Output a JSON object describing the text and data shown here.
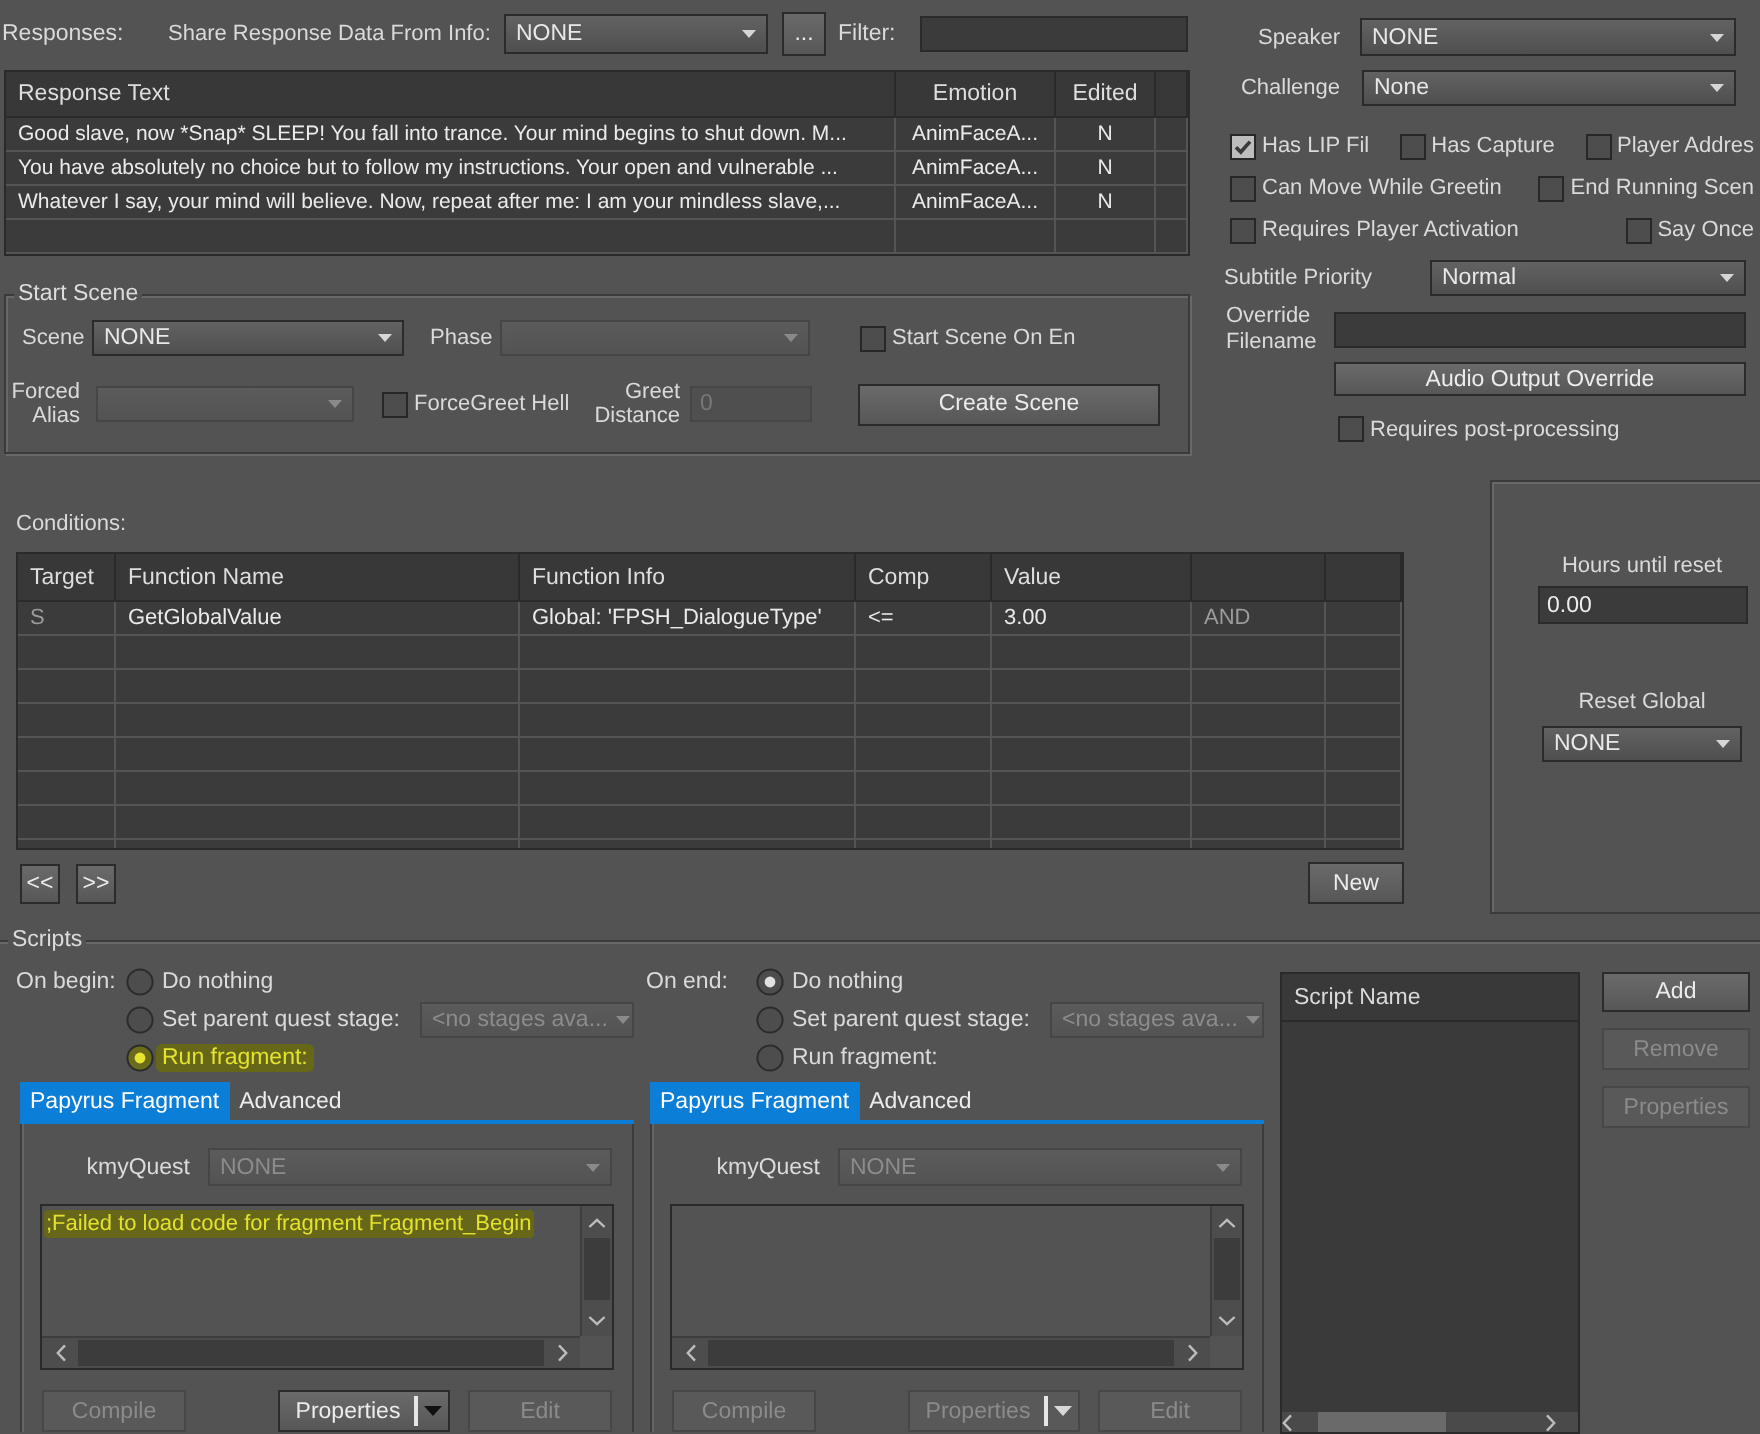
{
  "responses_bar": {
    "label": "Responses:",
    "share_label": "Share Response Data From Info:",
    "share_value": "NONE",
    "browse_button": "...",
    "filter_label": "Filter:"
  },
  "responses_table": {
    "columns": [
      "Response Text",
      "Emotion",
      "Edited"
    ],
    "rows": [
      [
        "Good slave, now *Snap* SLEEP! You fall into trance. Your mind begins to shut down. M...",
        "AnimFaceA...",
        "N"
      ],
      [
        "You have absolutely no choice but to follow my instructions. Your open and vulnerable ...",
        "AnimFaceA...",
        "N"
      ],
      [
        "Whatever I say, your mind will believe. Now, repeat after me: I am your mindless slave,...",
        "AnimFaceA...",
        "N"
      ]
    ]
  },
  "start_scene": {
    "title": "Start Scene",
    "scene": {
      "label": "Scene",
      "value": "NONE",
      "disabled": false
    },
    "phase": {
      "label": "Phase",
      "disabled": true
    },
    "start_on_end": {
      "label": "Start Scene On En",
      "checked": false
    },
    "forced_alias": {
      "label": "Forced Alias",
      "disabled": true
    },
    "force_greet": {
      "label": "ForceGreet Hell",
      "checked": false
    },
    "greet_distance": {
      "label": "Greet Distance",
      "value": "0",
      "disabled": true
    },
    "create_button": "Create Scene"
  },
  "dialogue": {
    "speaker": {
      "label": "Speaker",
      "value": "NONE"
    },
    "challenge": {
      "label": "Challenge",
      "value": "None"
    },
    "flag_rows": [
      [
        {
          "label": "Has LIP Fil",
          "checked": true
        },
        {
          "label": "Has Capture",
          "checked": false
        },
        {
          "label": "Player Addres",
          "checked": false
        }
      ],
      [
        {
          "label": "Can Move While Greetin",
          "checked": false
        },
        {
          "label": "End Running Scen",
          "checked": false
        }
      ],
      [
        {
          "label": "Requires Player Activation",
          "checked": false
        },
        {
          "label": "Say Once",
          "checked": false
        }
      ]
    ],
    "subtitle_priority": {
      "label": "Subtitle Priority",
      "value": "Normal"
    },
    "override_filename": {
      "label": "Override Filename"
    },
    "audio_button": "Audio Output Override",
    "post_processing": {
      "label": "Requires post-processing",
      "checked": false
    }
  },
  "conditions": {
    "label": "Conditions:",
    "columns": [
      "Target",
      "Function Name",
      "Function Info",
      "Comp",
      "Value"
    ],
    "rows": [
      [
        "S",
        "GetGlobalValue",
        "Global: 'FPSH_DialogueType'",
        "<=",
        "3.00",
        "AND"
      ]
    ],
    "back_button": "<<",
    "forward_button": ">>",
    "new_button": "New"
  },
  "reset": {
    "hours_label": "Hours until reset",
    "hours_value": "0.00",
    "global_label": "Reset Global",
    "global_value": "NONE"
  },
  "scripts": {
    "title": "Scripts",
    "fragments": [
      {
        "label": "On begin:",
        "options": [
          {
            "label": "Do nothing",
            "selected": false,
            "highlighted": false
          },
          {
            "label": "Set parent quest stage:",
            "selected": false,
            "highlighted": false,
            "stage": {
              "value": "<no stages ava...",
              "disabled": true
            }
          },
          {
            "label": "Run fragment:",
            "selected": true,
            "highlighted": true
          }
        ],
        "tabs": [
          {
            "label": "Papyrus Fragment",
            "selected": true
          },
          {
            "label": "Advanced",
            "selected": false
          }
        ],
        "kmyquest": {
          "label": "kmyQuest",
          "value": "NONE",
          "disabled": true
        },
        "code": {
          "text": ";Failed to load code for fragment Fragment_Begin",
          "highlighted": true
        },
        "buttons": [
          {
            "label": "Compile",
            "kind": "plain",
            "disabled": true
          },
          {
            "label": "Properties",
            "kind": "split",
            "disabled": false
          },
          {
            "label": "Edit",
            "kind": "plain",
            "disabled": true
          }
        ]
      },
      {
        "label": "On end:",
        "options": [
          {
            "label": "Do nothing",
            "selected": true,
            "highlighted": false
          },
          {
            "label": "Set parent quest stage:",
            "selected": false,
            "highlighted": false,
            "stage": {
              "value": "<no stages ava...",
              "disabled": true
            }
          },
          {
            "label": "Run fragment:",
            "selected": false,
            "highlighted": false
          }
        ],
        "tabs": [
          {
            "label": "Papyrus Fragment",
            "selected": true
          },
          {
            "label": "Advanced",
            "selected": false
          }
        ],
        "kmyquest": {
          "label": "kmyQuest",
          "value": "NONE",
          "disabled": true
        },
        "buttons": [
          {
            "label": "Compile",
            "kind": "plain",
            "disabled": true
          },
          {
            "label": "Properties",
            "kind": "split",
            "disabled": true
          },
          {
            "label": "Edit",
            "kind": "plain",
            "disabled": true
          }
        ]
      }
    ],
    "list": {
      "column": "Script Name"
    },
    "buttons": [
      {
        "label": "Add",
        "disabled": false
      },
      {
        "label": "Remove",
        "disabled": true
      },
      {
        "label": "Properties",
        "disabled": true
      }
    ]
  }
}
